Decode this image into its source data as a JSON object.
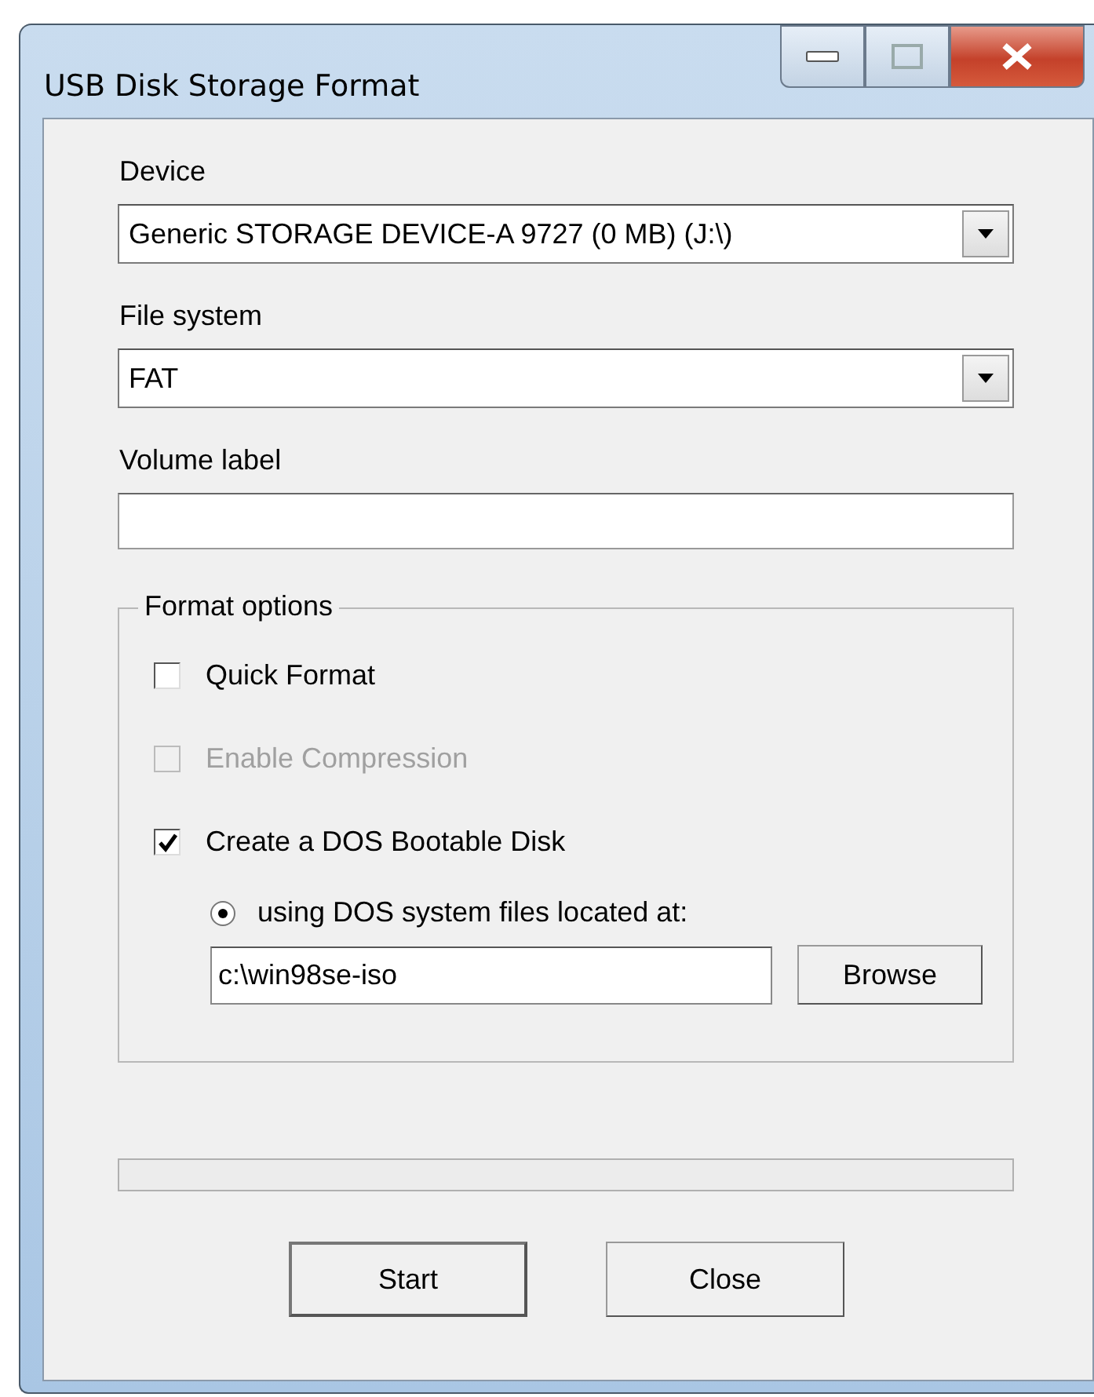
{
  "window": {
    "title": "USB Disk Storage Format"
  },
  "device": {
    "label": "Device",
    "value": "Generic STORAGE DEVICE-A 9727 (0 MB) (J:\\)"
  },
  "file_system": {
    "label": "File system",
    "value": "FAT"
  },
  "volume_label": {
    "label": "Volume label"
  },
  "format_options": {
    "title": "Format options",
    "options": [
      {
        "label": "Quick Format",
        "checked": false,
        "disabled": false
      },
      {
        "label": "Enable Compression",
        "checked": false,
        "disabled": true
      },
      {
        "label": "Create a DOS Bootable Disk",
        "checked": true,
        "disabled": false
      }
    ],
    "source": {
      "label": "using DOS system files located at:",
      "selected": true,
      "path": "c:\\win98se-iso",
      "browse": "Browse"
    }
  },
  "progress": {
    "level": 0
  },
  "buttons": [
    {
      "label": "Start",
      "default": true
    },
    {
      "label": "Close",
      "default": false
    }
  ]
}
